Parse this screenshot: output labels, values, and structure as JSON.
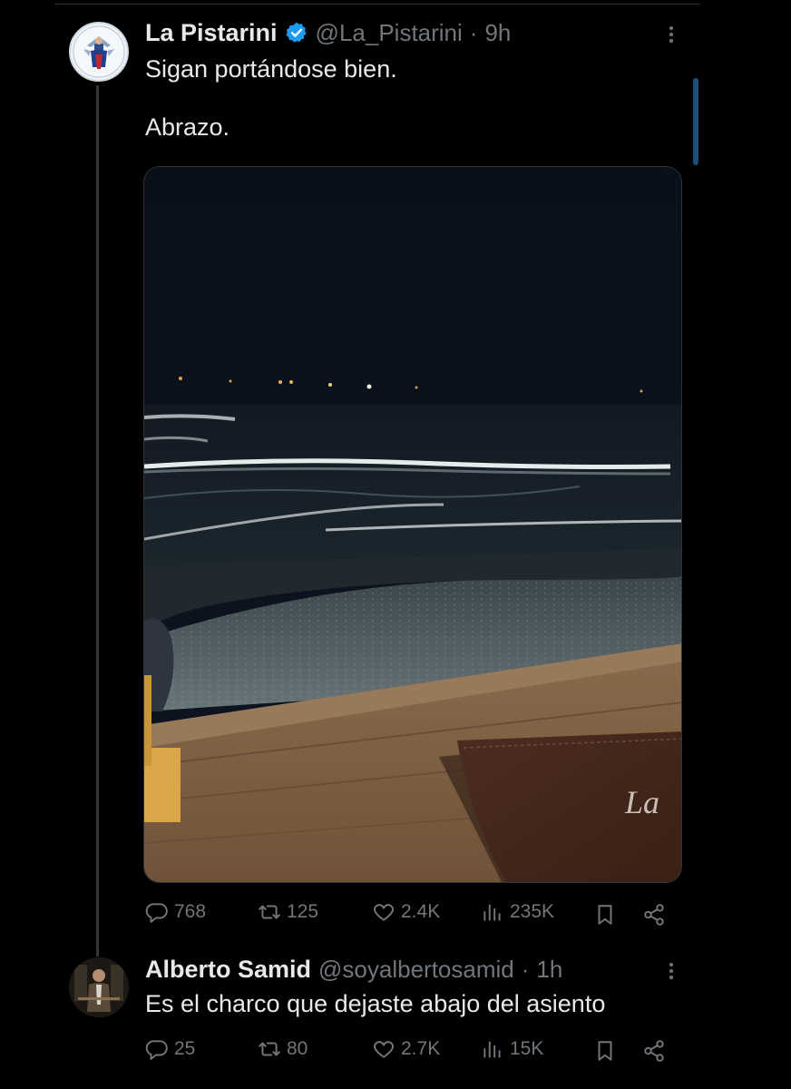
{
  "tweet": {
    "name": "La Pistarini",
    "handle": "@La_Pistarini",
    "dot": "·",
    "time": "9h",
    "text": "Sigan portándose bien.\n\nAbrazo.",
    "actions": {
      "replies": "768",
      "retweets": "125",
      "likes": "2.4K",
      "views": "235K"
    }
  },
  "reply": {
    "name": "Alberto Samid",
    "handle": "@soyalbertosamid",
    "dot": "·",
    "time": "1h",
    "text": "Es el charco que dejaste abajo del asiento",
    "actions": {
      "replies": "25",
      "retweets": "80",
      "likes": "2.7K",
      "views": "15K"
    }
  },
  "media": {
    "menu_lettering": "La"
  },
  "colors": {
    "background": "#000000",
    "text": "#e7e9ea",
    "muted": "#71767b",
    "verified": "#1d9bf0"
  }
}
